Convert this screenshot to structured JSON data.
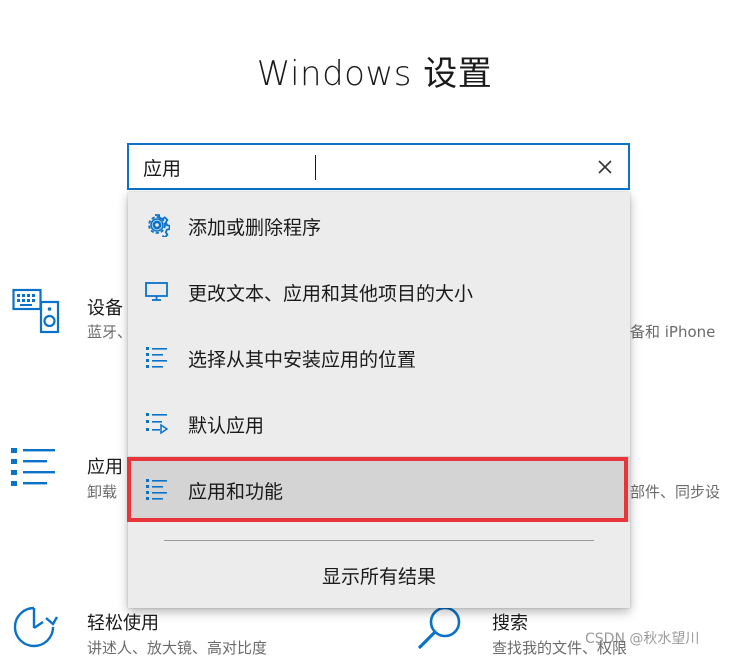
{
  "window": {
    "title": "Windows 设置"
  },
  "search": {
    "value": "应用",
    "clear_icon": "close-icon"
  },
  "dropdown": {
    "items": [
      {
        "label": "添加或删除程序",
        "icon": "gear-icon"
      },
      {
        "label": "更改文本、应用和其他项目的大小",
        "icon": "monitor-icon"
      },
      {
        "label": "选择从其中安装应用的位置",
        "icon": "list-icon"
      },
      {
        "label": "默认应用",
        "icon": "default-apps-icon"
      },
      {
        "label": "应用和功能",
        "icon": "list-icon",
        "selected": true
      }
    ],
    "show_all": "显示所有结果"
  },
  "tiles": {
    "devices": {
      "name": "设备",
      "desc": "蓝牙、",
      "desc_right": "备和 iPhone"
    },
    "apps": {
      "name": "应用",
      "desc": "卸载",
      "desc_right": "部件、同步设"
    },
    "ease": {
      "name": "轻松使用",
      "desc": "讲述人、放大镜、高对比度"
    },
    "search": {
      "name": "搜索",
      "desc": "查找我的文件、权限"
    }
  },
  "watermark": "CSDN @秋水望川",
  "colors": {
    "accent": "#0a73c9",
    "highlight": "#e8343a"
  }
}
